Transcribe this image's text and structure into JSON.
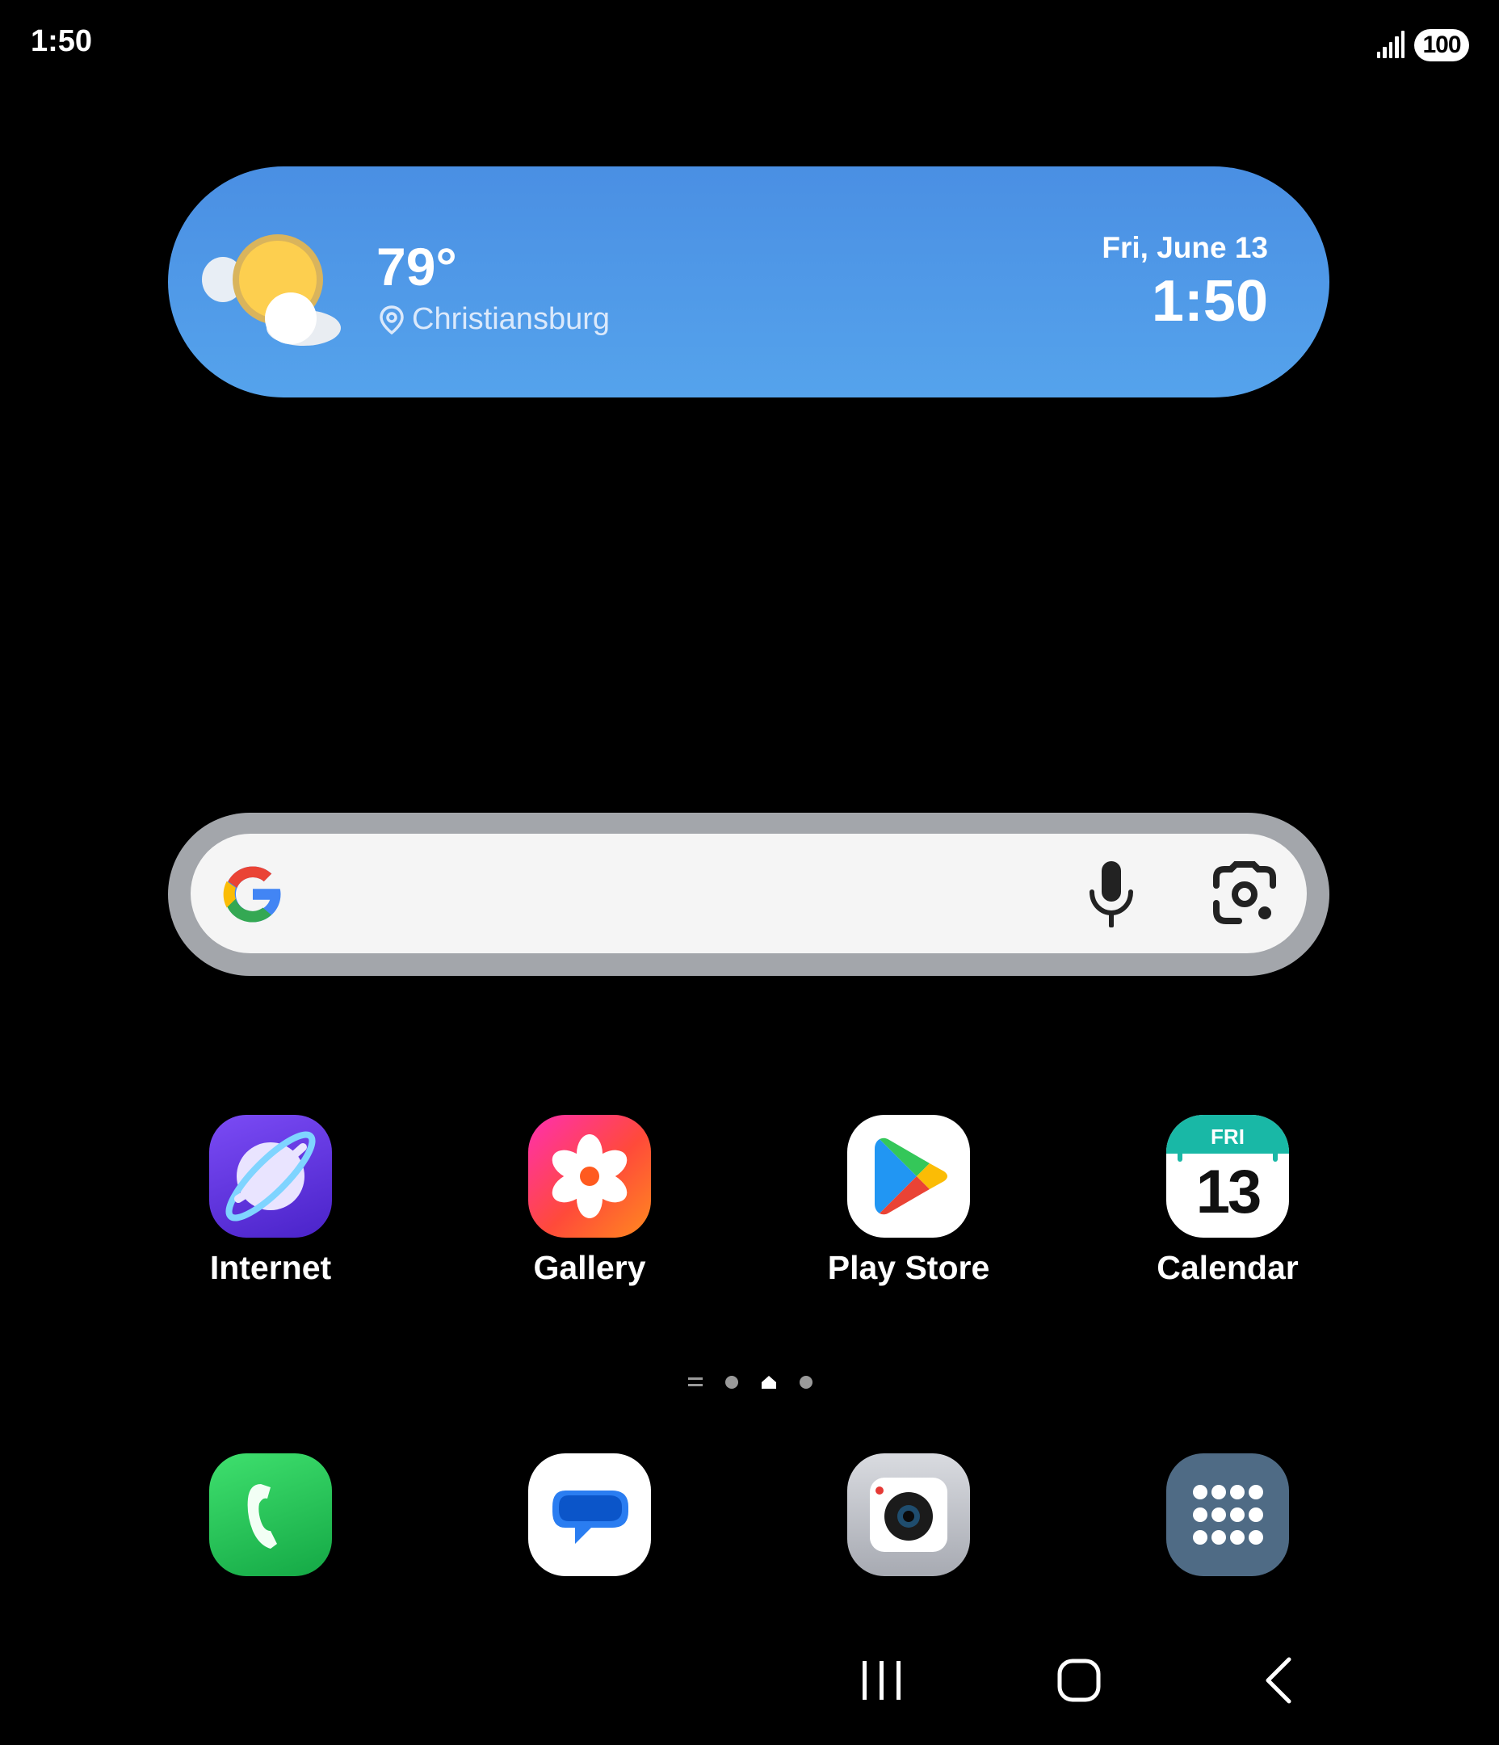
{
  "status_bar": {
    "time": "1:50",
    "battery": "100",
    "signal_icon": "signal-icon"
  },
  "weather": {
    "temperature": "79°",
    "location": "Christiansburg",
    "date": "Fri, June 13",
    "time": "1:50",
    "icon": "partly-sunny-icon",
    "background": "#4a8fe3"
  },
  "search": {
    "logo": "google-g-icon",
    "voice_icon": "mic-icon",
    "lens_icon": "lens-icon"
  },
  "apps": [
    {
      "label": "Internet",
      "icon": "internet-icon"
    },
    {
      "label": "Gallery",
      "icon": "gallery-icon"
    },
    {
      "label": "Play Store",
      "icon": "play-store-icon"
    },
    {
      "label": "Calendar",
      "icon": "calendar-icon",
      "day": "FRI",
      "date": "13"
    }
  ],
  "dock": [
    {
      "icon": "phone-icon"
    },
    {
      "icon": "messages-icon"
    },
    {
      "icon": "camera-icon"
    },
    {
      "icon": "app-drawer-icon"
    }
  ],
  "pager": {
    "pages": 3,
    "current": "home"
  },
  "nav": {
    "recent": "recent-apps-icon",
    "home": "home-icon",
    "back": "back-icon"
  }
}
